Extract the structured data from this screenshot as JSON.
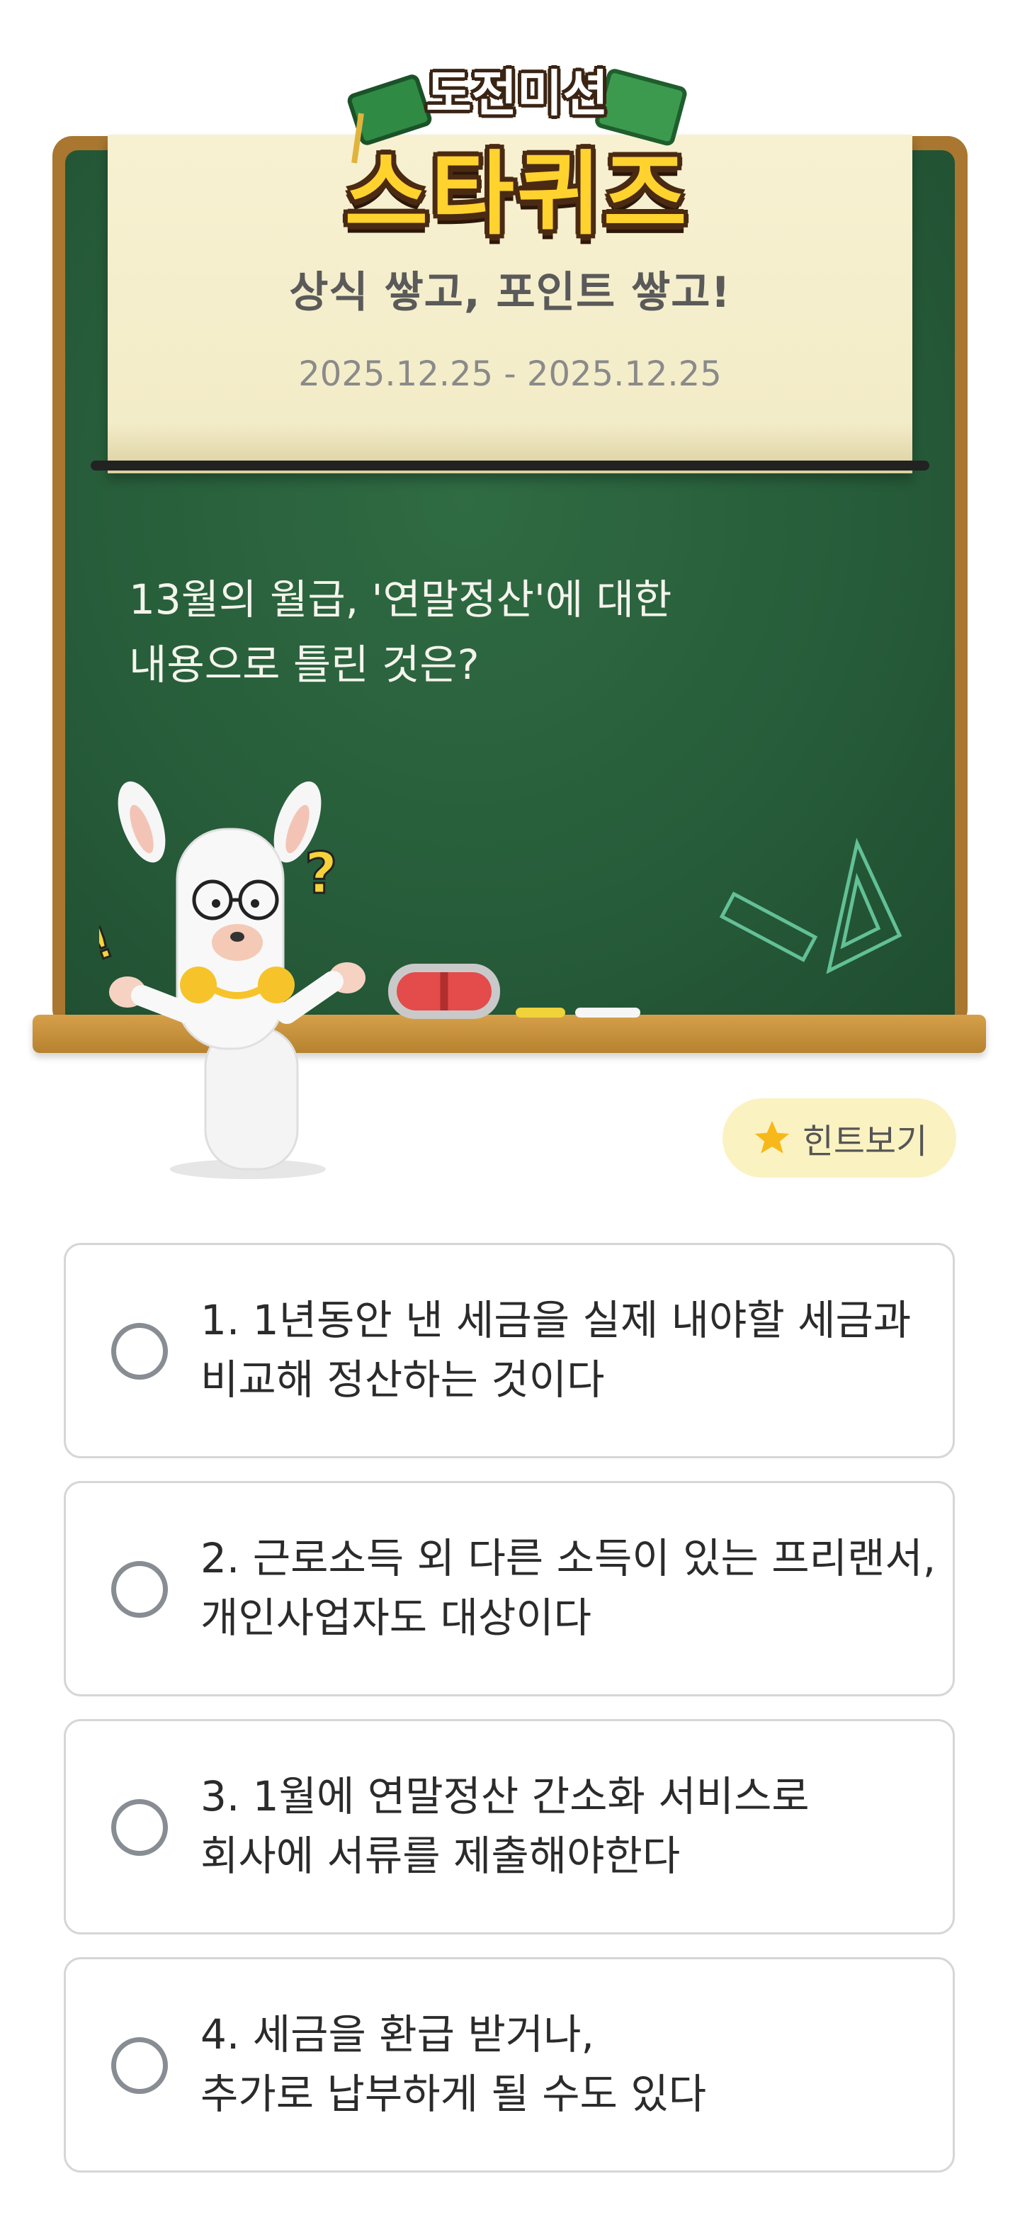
{
  "header": {
    "logo_top": "도전미션",
    "logo_main": "스타퀴즈",
    "subtitle": "상식 쌓고, 포인트 쌓고!",
    "date_range": "2025.12.25 - 2025.12.25"
  },
  "question": "13월의 월급, '연말정산'에 대한\n내용으로 틀린 것은?",
  "hint": {
    "label": "힌트보기",
    "icon": "star-icon"
  },
  "options": [
    {
      "label": "1. 1년동안 낸 세금을 실제 내야할 세금과\n비교해 정산하는 것이다"
    },
    {
      "label": "2. 근로소득 외 다른 소득이 있는 프리랜서,\n개인사업자도 대상이다"
    },
    {
      "label": "3. 1월에 연말정산 간소화 서비스로\n회사에 서류를 제출해야한다"
    },
    {
      "label": "4. 세금을 환급 받거나,\n추가로 납부하게 될 수도 있다"
    }
  ],
  "colors": {
    "board_green": "#275d3a",
    "board_frame": "#a9772f",
    "paper": "#f3ecc8",
    "logo_yellow": "#ffd22e",
    "hint_bg": "#fbf2c2",
    "option_border": "#d6d6d6"
  }
}
